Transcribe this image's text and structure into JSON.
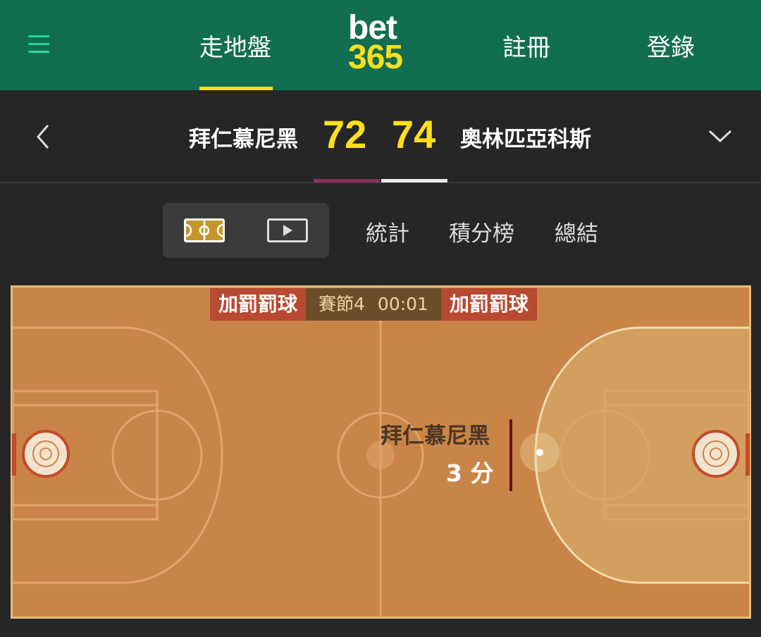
{
  "header": {
    "menu_icon": "hamburger-menu-icon",
    "nav_inplay": "走地盤",
    "nav_register": "註冊",
    "nav_login": "登錄",
    "logo_top": "bet",
    "logo_bottom": "365",
    "accent_color": "#ffdf1b",
    "brand_color": "#126e51"
  },
  "scoreboard": {
    "home_team": "拜仁慕尼黑",
    "home_score": "72",
    "away_score": "74",
    "away_team": "奧林匹亞科斯",
    "home_color": "#8a2f5c",
    "away_color": "#e8e8e8"
  },
  "tabs": {
    "court_view_icon": "court-icon",
    "video_icon": "play-video-icon",
    "stats": "統計",
    "standings": "積分榜",
    "summary": "總結"
  },
  "court": {
    "banner_left": "加罰罰球",
    "quarter": "賽節4",
    "clock": "00:01",
    "banner_right": "加罰罰球",
    "play_team": "拜仁慕尼黑",
    "play_points": "3 分"
  }
}
